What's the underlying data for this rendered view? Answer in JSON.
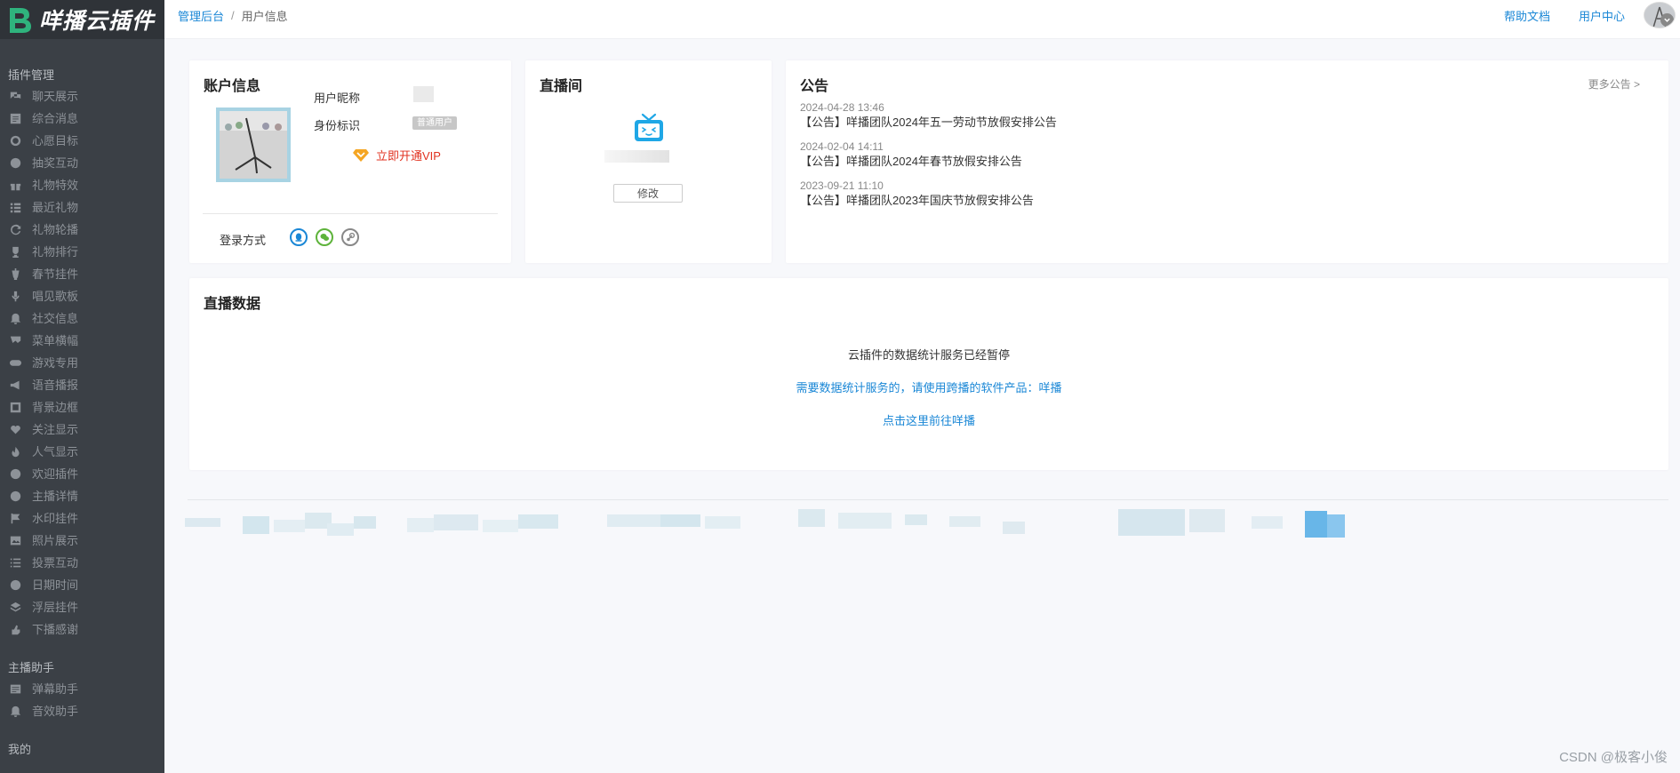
{
  "app": {
    "logo_text": "咩播云插件"
  },
  "sidebar": {
    "sections": [
      {
        "title": "插件管理",
        "items": [
          {
            "label": "聊天展示",
            "icon": "chat-icon"
          },
          {
            "label": "综合消息",
            "icon": "message-icon"
          },
          {
            "label": "心愿目标",
            "icon": "target-icon"
          },
          {
            "label": "抽奖互动",
            "icon": "lottery-icon"
          },
          {
            "label": "礼物特效",
            "icon": "gift-icon"
          },
          {
            "label": "最近礼物",
            "icon": "list-icon"
          },
          {
            "label": "礼物轮播",
            "icon": "refresh-icon"
          },
          {
            "label": "礼物排行",
            "icon": "trophy-icon"
          },
          {
            "label": "春节挂件",
            "icon": "lantern-icon"
          },
          {
            "label": "唱见歌板",
            "icon": "microphone-icon"
          },
          {
            "label": "社交信息",
            "icon": "bell-icon"
          },
          {
            "label": "菜单横幅",
            "icon": "banner-icon"
          },
          {
            "label": "游戏专用",
            "icon": "gamepad-icon"
          },
          {
            "label": "语音播报",
            "icon": "megaphone-icon"
          },
          {
            "label": "背景边框",
            "icon": "frame-icon"
          },
          {
            "label": "关注显示",
            "icon": "heart-icon"
          },
          {
            "label": "人气显示",
            "icon": "fire-icon"
          },
          {
            "label": "欢迎插件",
            "icon": "smile-icon"
          },
          {
            "label": "主播详情",
            "icon": "info-icon"
          },
          {
            "label": "水印挂件",
            "icon": "flag-icon"
          },
          {
            "label": "照片展示",
            "icon": "image-icon"
          },
          {
            "label": "投票互动",
            "icon": "vote-list-icon"
          },
          {
            "label": "日期时间",
            "icon": "clock-icon"
          },
          {
            "label": "浮层挂件",
            "icon": "layers-icon"
          },
          {
            "label": "下播感谢",
            "icon": "hand-icon"
          }
        ]
      },
      {
        "title": "主播助手",
        "items": [
          {
            "label": "弹幕助手",
            "icon": "danmaku-icon"
          },
          {
            "label": "音效助手",
            "icon": "bell-icon"
          }
        ]
      },
      {
        "title": "我的",
        "items": []
      }
    ]
  },
  "topbar": {
    "breadcrumb_root": "管理后台",
    "breadcrumb_sep": "/",
    "breadcrumb_current": "用户信息",
    "help_docs": "帮助文档",
    "user_center": "用户中心"
  },
  "account": {
    "title": "账户信息",
    "nickname_label": "用户昵称",
    "identity_label": "身份标识",
    "identity_badge": "普通用户",
    "vip_link": "立即开通VIP",
    "login_label": "登录方式",
    "login_methods": [
      "qq-icon",
      "wechat-icon",
      "steam-icon"
    ]
  },
  "live_room": {
    "title": "直播间",
    "edit_button": "修改"
  },
  "notice": {
    "title": "公告",
    "more": "更多公告 >",
    "items": [
      {
        "date": "2024-04-28 13:46",
        "text": "【公告】咩播团队2024年五一劳动节放假安排公告"
      },
      {
        "date": "2024-02-04 14:11",
        "text": "【公告】咩播团队2024年春节放假安排公告"
      },
      {
        "date": "2023-09-21 11:10",
        "text": "【公告】咩播团队2023年国庆节放假安排公告"
      }
    ]
  },
  "live_data": {
    "title": "直播数据",
    "paused": "云插件的数据统计服务已经暂停",
    "note": "需要数据统计服务的，请使用跨播的软件产品：咩播",
    "link": "点击这里前往咩播"
  },
  "watermark": "CSDN @极客小俊",
  "colors": {
    "sidebar_bg": "#3b4046",
    "link_blue": "#1a87d6",
    "vip_red": "#e1311f",
    "tv_blue": "#1fa7e6",
    "qq_blue": "#1a87d6",
    "wechat_green": "#5eb33b",
    "steam_gray": "#888888"
  }
}
